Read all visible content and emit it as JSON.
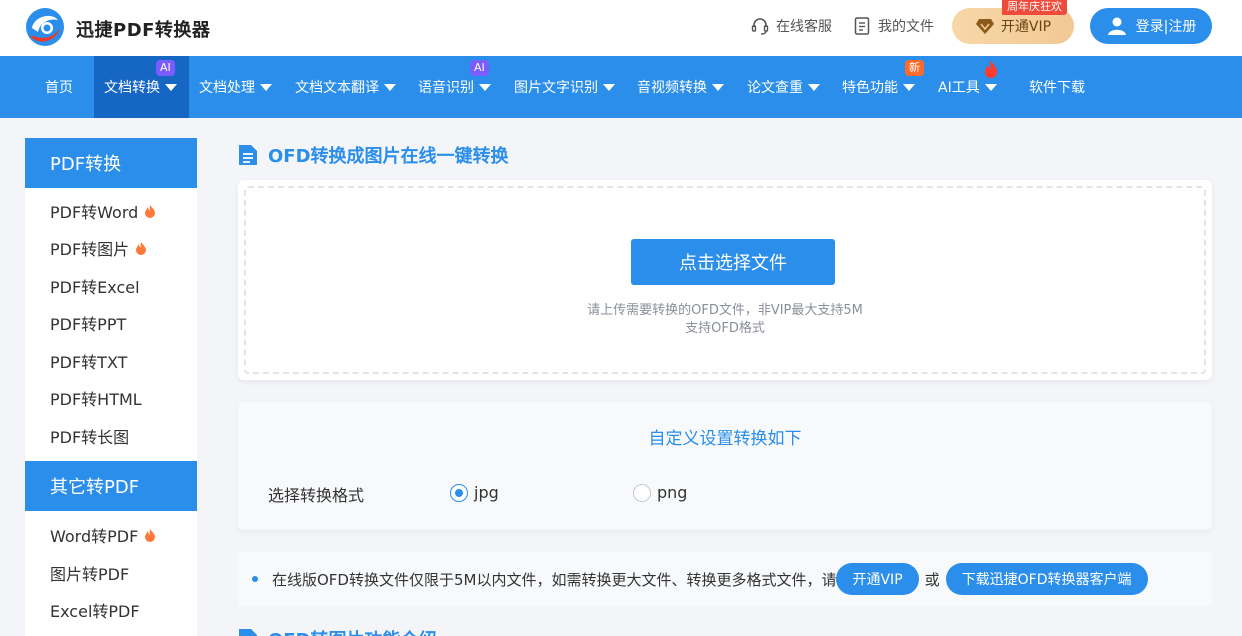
{
  "header": {
    "brand": "迅捷PDF转换器",
    "service": "在线客服",
    "my_files": "我的文件",
    "vip_label": "开通VIP",
    "vip_tag": "周年庆狂欢",
    "login_label": "登录|注册"
  },
  "nav": {
    "items": [
      {
        "label": "首页"
      },
      {
        "label": "文档转换",
        "badge": "AI"
      },
      {
        "label": "文档处理"
      },
      {
        "label": "文档文本翻译"
      },
      {
        "label": "语音识别",
        "badge": "AI"
      },
      {
        "label": "图片文字识别"
      },
      {
        "label": "音视频转换"
      },
      {
        "label": "论文查重"
      },
      {
        "label": "特色功能",
        "badge": "新"
      },
      {
        "label": "AI工具"
      },
      {
        "label": "软件下载"
      }
    ]
  },
  "sidebar": {
    "section1": "PDF转换",
    "items1": [
      "PDF转Word",
      "PDF转图片",
      "PDF转Excel",
      "PDF转PPT",
      "PDF转TXT",
      "PDF转HTML",
      "PDF转长图"
    ],
    "section2": "其它转PDF",
    "items2": [
      "Word转PDF",
      "图片转PDF",
      "Excel转PDF"
    ]
  },
  "main": {
    "title": "OFD转换成图片在线一键转换",
    "pick_label": "点击选择文件",
    "hint1": "请上传需要转换的OFD文件，非VIP最大支持5M",
    "hint2": "支持OFD格式",
    "settings_title": "自定义设置转换如下",
    "format_label": "选择转换格式",
    "format_jpg": "jpg",
    "format_png": "png",
    "notice_text": "在线版OFD转换文件仅限于5M以内文件，如需转换更大文件、转换更多格式文件，请",
    "notice_vip": "开通VIP",
    "notice_or": "或",
    "notice_download": "下载迅捷OFD转换器客户端",
    "next_title": "OFD转图片功能介绍"
  },
  "colors": {
    "primary": "#2a8eea",
    "nav_active": "#1667c4",
    "vip_gold": "#f2c894"
  }
}
